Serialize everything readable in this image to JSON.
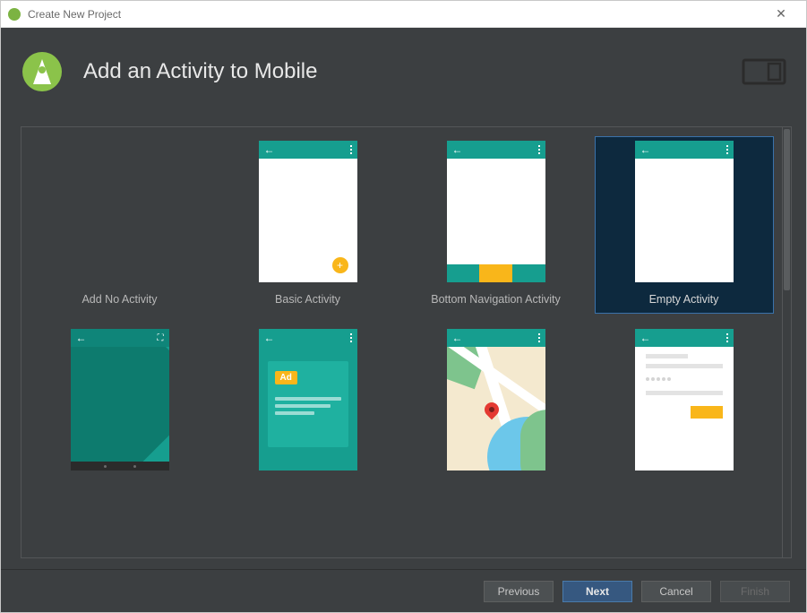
{
  "window": {
    "title": "Create New Project"
  },
  "header": {
    "title": "Add an Activity to Mobile"
  },
  "templates": [
    {
      "label": "Add No Activity",
      "type": "none"
    },
    {
      "label": "Basic Activity",
      "type": "basic"
    },
    {
      "label": "Bottom Navigation Activity",
      "type": "bottomnav"
    },
    {
      "label": "Empty Activity",
      "type": "empty",
      "selected": true
    },
    {
      "label": "",
      "type": "fullscreen"
    },
    {
      "label": "",
      "type": "admob",
      "ad_text": "Ad"
    },
    {
      "label": "",
      "type": "maps"
    },
    {
      "label": "",
      "type": "login"
    }
  ],
  "buttons": {
    "previous": "Previous",
    "next": "Next",
    "cancel": "Cancel",
    "finish": "Finish"
  }
}
